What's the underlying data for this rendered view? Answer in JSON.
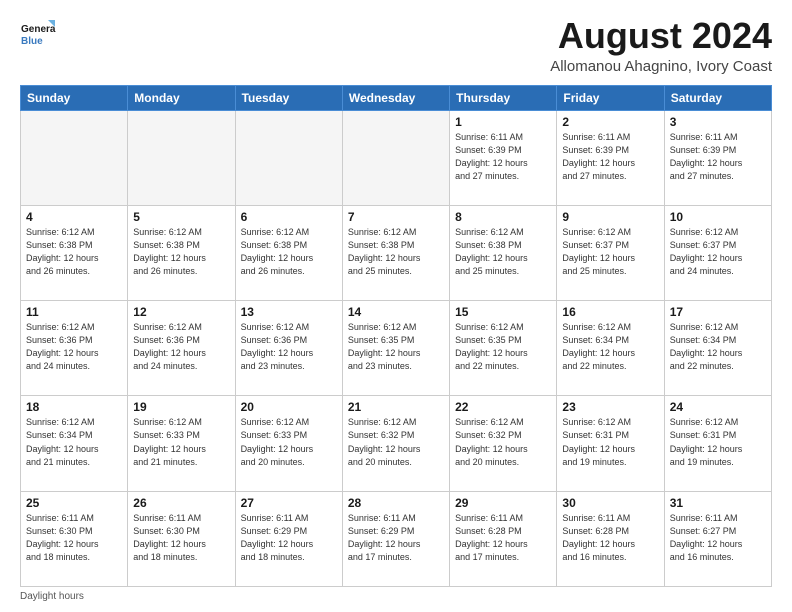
{
  "header": {
    "logo_line1": "General",
    "logo_line2": "Blue",
    "main_title": "August 2024",
    "sub_title": "Allomanou Ahagnino, Ivory Coast"
  },
  "calendar": {
    "days_of_week": [
      "Sunday",
      "Monday",
      "Tuesday",
      "Wednesday",
      "Thursday",
      "Friday",
      "Saturday"
    ],
    "weeks": [
      [
        {
          "day": "",
          "info": ""
        },
        {
          "day": "",
          "info": ""
        },
        {
          "day": "",
          "info": ""
        },
        {
          "day": "",
          "info": ""
        },
        {
          "day": "1",
          "info": "Sunrise: 6:11 AM\nSunset: 6:39 PM\nDaylight: 12 hours\nand 27 minutes."
        },
        {
          "day": "2",
          "info": "Sunrise: 6:11 AM\nSunset: 6:39 PM\nDaylight: 12 hours\nand 27 minutes."
        },
        {
          "day": "3",
          "info": "Sunrise: 6:11 AM\nSunset: 6:39 PM\nDaylight: 12 hours\nand 27 minutes."
        }
      ],
      [
        {
          "day": "4",
          "info": "Sunrise: 6:12 AM\nSunset: 6:38 PM\nDaylight: 12 hours\nand 26 minutes."
        },
        {
          "day": "5",
          "info": "Sunrise: 6:12 AM\nSunset: 6:38 PM\nDaylight: 12 hours\nand 26 minutes."
        },
        {
          "day": "6",
          "info": "Sunrise: 6:12 AM\nSunset: 6:38 PM\nDaylight: 12 hours\nand 26 minutes."
        },
        {
          "day": "7",
          "info": "Sunrise: 6:12 AM\nSunset: 6:38 PM\nDaylight: 12 hours\nand 25 minutes."
        },
        {
          "day": "8",
          "info": "Sunrise: 6:12 AM\nSunset: 6:38 PM\nDaylight: 12 hours\nand 25 minutes."
        },
        {
          "day": "9",
          "info": "Sunrise: 6:12 AM\nSunset: 6:37 PM\nDaylight: 12 hours\nand 25 minutes."
        },
        {
          "day": "10",
          "info": "Sunrise: 6:12 AM\nSunset: 6:37 PM\nDaylight: 12 hours\nand 24 minutes."
        }
      ],
      [
        {
          "day": "11",
          "info": "Sunrise: 6:12 AM\nSunset: 6:36 PM\nDaylight: 12 hours\nand 24 minutes."
        },
        {
          "day": "12",
          "info": "Sunrise: 6:12 AM\nSunset: 6:36 PM\nDaylight: 12 hours\nand 24 minutes."
        },
        {
          "day": "13",
          "info": "Sunrise: 6:12 AM\nSunset: 6:36 PM\nDaylight: 12 hours\nand 23 minutes."
        },
        {
          "day": "14",
          "info": "Sunrise: 6:12 AM\nSunset: 6:35 PM\nDaylight: 12 hours\nand 23 minutes."
        },
        {
          "day": "15",
          "info": "Sunrise: 6:12 AM\nSunset: 6:35 PM\nDaylight: 12 hours\nand 22 minutes."
        },
        {
          "day": "16",
          "info": "Sunrise: 6:12 AM\nSunset: 6:34 PM\nDaylight: 12 hours\nand 22 minutes."
        },
        {
          "day": "17",
          "info": "Sunrise: 6:12 AM\nSunset: 6:34 PM\nDaylight: 12 hours\nand 22 minutes."
        }
      ],
      [
        {
          "day": "18",
          "info": "Sunrise: 6:12 AM\nSunset: 6:34 PM\nDaylight: 12 hours\nand 21 minutes."
        },
        {
          "day": "19",
          "info": "Sunrise: 6:12 AM\nSunset: 6:33 PM\nDaylight: 12 hours\nand 21 minutes."
        },
        {
          "day": "20",
          "info": "Sunrise: 6:12 AM\nSunset: 6:33 PM\nDaylight: 12 hours\nand 20 minutes."
        },
        {
          "day": "21",
          "info": "Sunrise: 6:12 AM\nSunset: 6:32 PM\nDaylight: 12 hours\nand 20 minutes."
        },
        {
          "day": "22",
          "info": "Sunrise: 6:12 AM\nSunset: 6:32 PM\nDaylight: 12 hours\nand 20 minutes."
        },
        {
          "day": "23",
          "info": "Sunrise: 6:12 AM\nSunset: 6:31 PM\nDaylight: 12 hours\nand 19 minutes."
        },
        {
          "day": "24",
          "info": "Sunrise: 6:12 AM\nSunset: 6:31 PM\nDaylight: 12 hours\nand 19 minutes."
        }
      ],
      [
        {
          "day": "25",
          "info": "Sunrise: 6:11 AM\nSunset: 6:30 PM\nDaylight: 12 hours\nand 18 minutes."
        },
        {
          "day": "26",
          "info": "Sunrise: 6:11 AM\nSunset: 6:30 PM\nDaylight: 12 hours\nand 18 minutes."
        },
        {
          "day": "27",
          "info": "Sunrise: 6:11 AM\nSunset: 6:29 PM\nDaylight: 12 hours\nand 18 minutes."
        },
        {
          "day": "28",
          "info": "Sunrise: 6:11 AM\nSunset: 6:29 PM\nDaylight: 12 hours\nand 17 minutes."
        },
        {
          "day": "29",
          "info": "Sunrise: 6:11 AM\nSunset: 6:28 PM\nDaylight: 12 hours\nand 17 minutes."
        },
        {
          "day": "30",
          "info": "Sunrise: 6:11 AM\nSunset: 6:28 PM\nDaylight: 12 hours\nand 16 minutes."
        },
        {
          "day": "31",
          "info": "Sunrise: 6:11 AM\nSunset: 6:27 PM\nDaylight: 12 hours\nand 16 minutes."
        }
      ]
    ]
  },
  "footer": {
    "note": "Daylight hours"
  }
}
